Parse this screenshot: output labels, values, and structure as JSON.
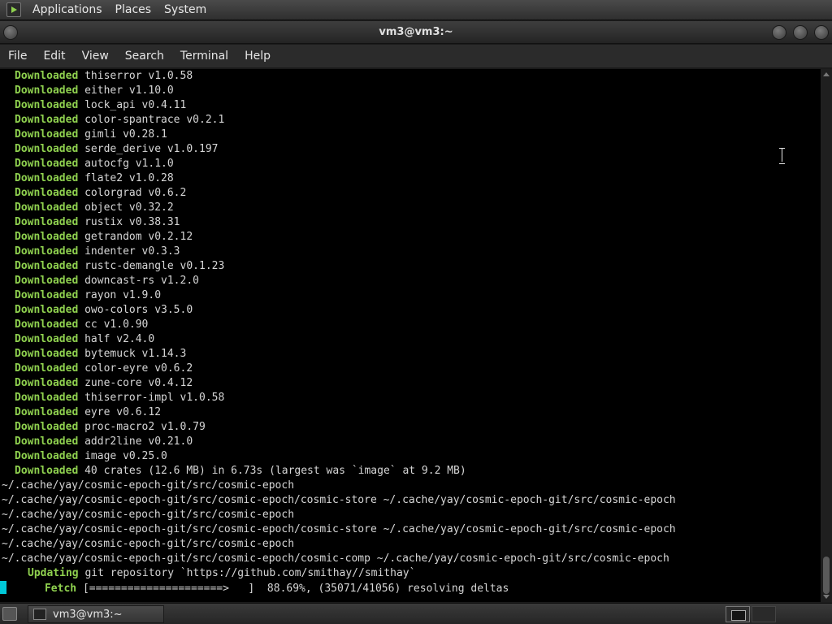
{
  "top_panel": {
    "menus": [
      "Applications",
      "Places",
      "System"
    ]
  },
  "window": {
    "title": "vm3@vm3:~"
  },
  "menubar": {
    "items": [
      "File",
      "Edit",
      "View",
      "Search",
      "Terminal",
      "Help"
    ]
  },
  "terminal": {
    "downloaded_label": "Downloaded",
    "downloads": [
      "thiserror v1.0.58",
      "either v1.10.0",
      "lock_api v0.4.11",
      "color-spantrace v0.2.1",
      "gimli v0.28.1",
      "serde_derive v1.0.197",
      "autocfg v1.1.0",
      "flate2 v1.0.28",
      "colorgrad v0.6.2",
      "object v0.32.2",
      "rustix v0.38.31",
      "getrandom v0.2.12",
      "indenter v0.3.3",
      "rustc-demangle v0.1.23",
      "downcast-rs v1.2.0",
      "rayon v1.9.0",
      "owo-colors v3.5.0",
      "cc v1.0.90",
      "half v2.4.0",
      "bytemuck v1.14.3",
      "color-eyre v0.6.2",
      "zune-core v0.4.12",
      "thiserror-impl v1.0.58",
      "eyre v0.6.12",
      "proc-macro2 v1.0.79",
      "addr2line v0.21.0",
      "image v0.25.0",
      "40 crates (12.6 MB) in 6.73s (largest was `image` at 9.2 MB)"
    ],
    "paths": [
      "~/.cache/yay/cosmic-epoch-git/src/cosmic-epoch",
      "~/.cache/yay/cosmic-epoch-git/src/cosmic-epoch/cosmic-store ~/.cache/yay/cosmic-epoch-git/src/cosmic-epoch",
      "~/.cache/yay/cosmic-epoch-git/src/cosmic-epoch",
      "~/.cache/yay/cosmic-epoch-git/src/cosmic-epoch/cosmic-store ~/.cache/yay/cosmic-epoch-git/src/cosmic-epoch",
      "~/.cache/yay/cosmic-epoch-git/src/cosmic-epoch",
      "~/.cache/yay/cosmic-epoch-git/src/cosmic-epoch/cosmic-comp ~/.cache/yay/cosmic-epoch-git/src/cosmic-epoch"
    ],
    "updating_label": "Updating",
    "updating_text": "git repository `https://github.com/smithay//smithay`",
    "fetch_label": "Fetch",
    "fetch_text": "[=====================>   ]  88.69%, (35071/41056) resolving deltas",
    "fetch_progress_percent": 88.69
  },
  "taskbar": {
    "task_label": "vm3@vm3:~"
  },
  "colors": {
    "keyword_green": "#8fd14f",
    "cursor_cyan": "#00c8d8",
    "terminal_bg": "#000000",
    "terminal_fg": "#d6d6d6"
  },
  "icons": [
    "terminal-app-icon",
    "window-menu-icon",
    "minimize-icon",
    "maximize-icon",
    "close-icon",
    "show-desktop-icon",
    "terminal-task-icon",
    "workspace-switcher-icon"
  ]
}
